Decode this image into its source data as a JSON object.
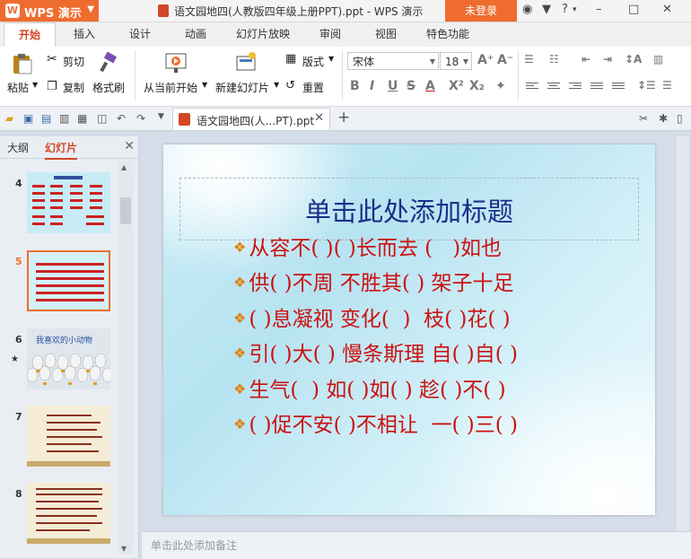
{
  "app": {
    "name": "WPS 演示",
    "logo": "W"
  },
  "window": {
    "title": "语文园地四(人教版四年级上册PPT).ppt - WPS 演示",
    "login": "未登录"
  },
  "ribbon_tabs": [
    "开始",
    "插入",
    "设计",
    "动画",
    "幻灯片放映",
    "审阅",
    "视图",
    "特色功能"
  ],
  "ribbon": {
    "paste": "粘贴",
    "cut": "剪切",
    "copy": "复制",
    "format_painter": "格式刷",
    "from_current": "从当前开始",
    "new_slide": "新建幻灯片",
    "layout": "版式",
    "reset": "重置",
    "font_name": "宋体",
    "font_size": "18"
  },
  "doc_tab": {
    "label": "语文园地四(人...PT).ppt"
  },
  "left_panel": {
    "tab_outline": "大纲",
    "tab_slides": "幻灯片",
    "slides": [
      {
        "num": "4"
      },
      {
        "num": "5"
      },
      {
        "num": "6",
        "title": "我喜欢的小动物"
      },
      {
        "num": "7"
      },
      {
        "num": "8"
      }
    ]
  },
  "slide": {
    "title": "单击此处添加标题",
    "lines": [
      "从容不( )( )长而去 (   )如也",
      "供( )不周 不胜其( ) 架子十足",
      "( )息凝视 变化(  )  枝( )花( )",
      "引( )大( ) 慢条斯理 自( )自( )",
      "生气(  ) 如( )如( ) 趁( )不( )",
      "( )促不安( )不相让  一( )三( )"
    ]
  },
  "notes_placeholder": "单击此处添加备注",
  "colors": {
    "accent": "#ef6c2f",
    "title": "#1a2f8a",
    "text": "#cc1111"
  }
}
